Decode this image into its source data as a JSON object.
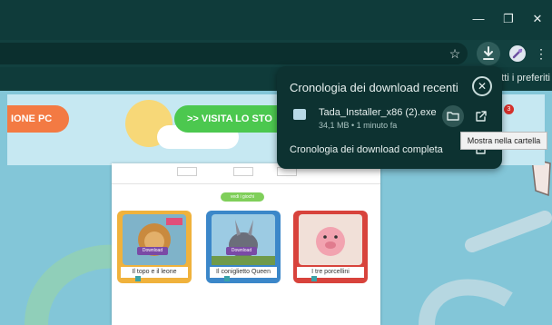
{
  "window": {
    "minimize_glyph": "—",
    "restore_glyph": "❐",
    "close_glyph": "✕"
  },
  "toolbar": {
    "star_glyph": "☆",
    "download_glyph": "⤓",
    "menu_glyph": "⋮"
  },
  "bookmarks": {
    "all_bookmarks_label": "tti i preferiti"
  },
  "page": {
    "left_button_label": "IONE PC",
    "visit_button_label": ">> VISITA LO STO",
    "mini_tabs": [
      "",
      "",
      "",
      "",
      ""
    ],
    "vedi_label": "vedi i giochi",
    "cards": [
      {
        "title": "Il topo e il leone",
        "badge": "Download"
      },
      {
        "title": "Il coniglietto Queen",
        "badge": "Download"
      },
      {
        "title": "I tre porcellini",
        "badge": ""
      }
    ],
    "notification_count": "3"
  },
  "download_panel": {
    "title": "Cronologia dei download recenti",
    "close_glyph": "✕",
    "file_name": "Tada_Installer_x86 (2).exe",
    "file_meta": "34,1 MB • 1 minuto fa",
    "folder_glyph": "🗀",
    "open_glyph": "↗",
    "full_history_label": "Cronologia dei download completa",
    "full_history_open_glyph": "↗",
    "tooltip": "Mostra nella cartella"
  },
  "colors": {
    "frame": "#0f3b3a",
    "panel": "#0d3231",
    "page_bg": "#83c6d8",
    "green_button": "#4cc84f",
    "orange_button": "#f37a43"
  }
}
